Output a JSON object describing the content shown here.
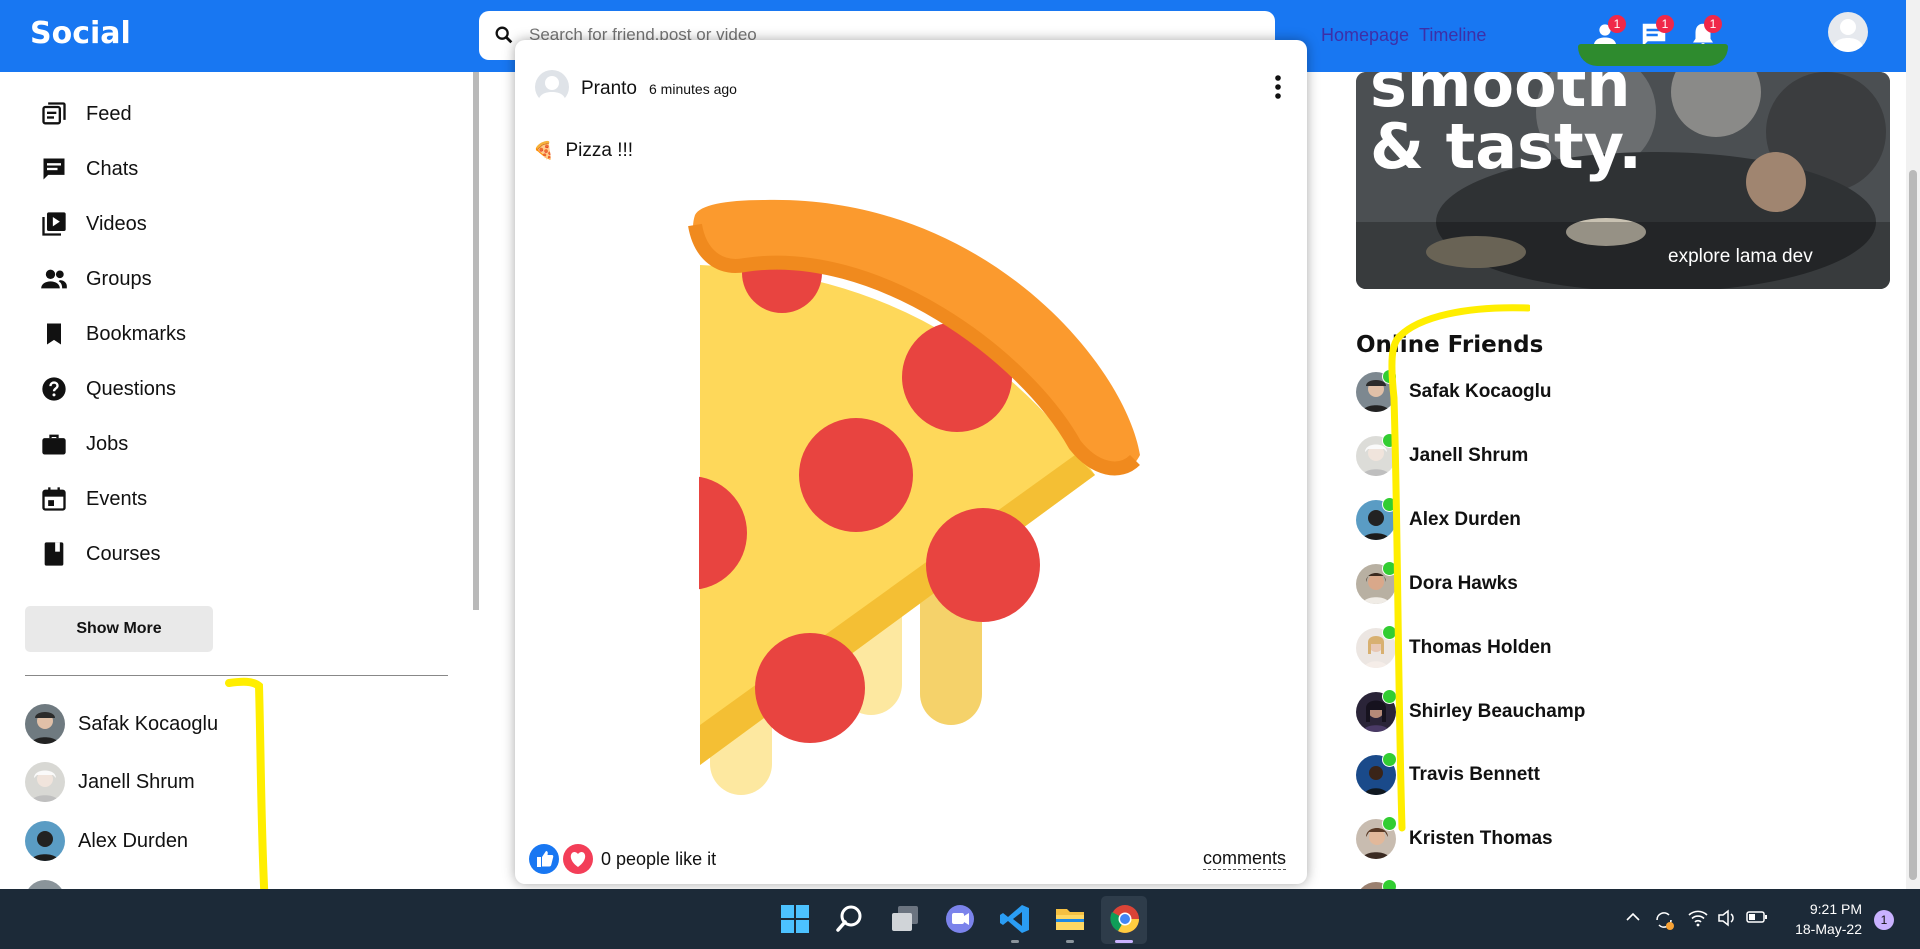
{
  "header": {
    "logo": "Social",
    "search_placeholder": "Search for friend.post or video",
    "links": [
      "Homepage",
      "Timeline"
    ],
    "badges": [
      "1",
      "1",
      "1"
    ]
  },
  "sidebar": {
    "items": [
      {
        "label": "Feed",
        "icon": "feed-icon"
      },
      {
        "label": "Chats",
        "icon": "chat-icon"
      },
      {
        "label": "Videos",
        "icon": "video-icon"
      },
      {
        "label": "Groups",
        "icon": "groups-icon"
      },
      {
        "label": "Bookmarks",
        "icon": "bookmark-icon"
      },
      {
        "label": "Questions",
        "icon": "question-icon"
      },
      {
        "label": "Jobs",
        "icon": "briefcase-icon"
      },
      {
        "label": "Events",
        "icon": "calendar-icon"
      },
      {
        "label": "Courses",
        "icon": "book-icon"
      }
    ],
    "show_more": "Show More",
    "friends": [
      "Safak Kocaoglu",
      "Janell Shrum",
      "Alex Durden"
    ]
  },
  "post": {
    "user": "Pranto",
    "time": "6 minutes ago",
    "text": "Pizza !!!",
    "emoji": "🍕",
    "likes": "0 people like it",
    "comments": "comments"
  },
  "ad": {
    "headline_1": "smooth",
    "headline_2": "& tasty.",
    "caption": "explore lama dev"
  },
  "online": {
    "title": "Online Friends",
    "friends": [
      "Safak Kocaoglu",
      "Janell Shrum",
      "Alex Durden",
      "Dora Hawks",
      "Thomas Holden",
      "Shirley Beauchamp",
      "Travis Bennett",
      "Kristen Thomas"
    ]
  },
  "taskbar": {
    "time": "9:21 PM",
    "date": "18-May-22",
    "notifications": "1"
  },
  "colors": {
    "brand": "#1877f2",
    "online": "#32cd32",
    "badge": "#f02849",
    "highlight": "#ffee00"
  }
}
